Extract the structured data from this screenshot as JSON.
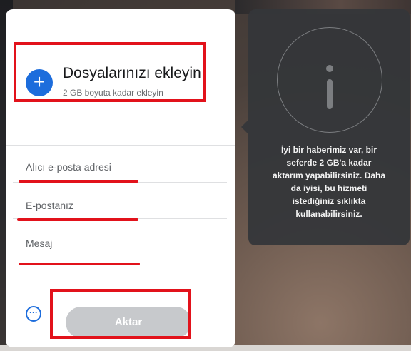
{
  "upload": {
    "title": "Dosyalarınızı ekleyin",
    "subtitle": "2 GB boyuta kadar ekleyin",
    "add_icon": "plus-icon"
  },
  "form": {
    "recipient_placeholder": "Alıcı e-posta adresi",
    "sender_placeholder": "E-postanız",
    "message_placeholder": "Mesaj"
  },
  "actions": {
    "more_icon": "more-options-icon",
    "more_symbol": "···",
    "transfer_label": "Aktar"
  },
  "info_panel": {
    "icon": "info-icon",
    "text": "İyi bir haberimiz var, bir\nseferde 2 GB'a kadar\naktarım yapabilirsiniz. Daha\nda iyisi, bu hizmeti\nistediğiniz sıklıkta\nkullanabilirsiniz."
  },
  "colors": {
    "accent": "#1d6ddc",
    "highlight": "#e2121b",
    "button_disabled": "#c7c9cc",
    "panel": "#343639"
  }
}
